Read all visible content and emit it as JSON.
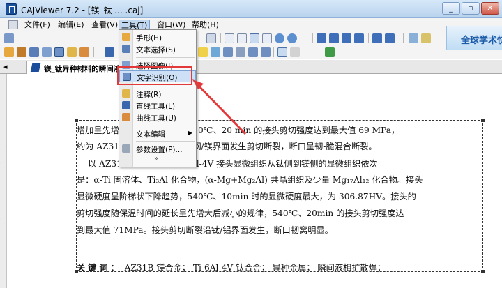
{
  "window": {
    "title": "CAJViewer 7.2 - [镁_钛 ... .caj]",
    "buttons": {
      "minimize": "_",
      "restore": "▫",
      "close": "✕"
    }
  },
  "menubar": {
    "items": [
      {
        "label": "文件(F)"
      },
      {
        "label": "编辑(E)"
      },
      {
        "label": "查看(V)"
      },
      {
        "label": "工具(T)",
        "active": true
      },
      {
        "label": "窗口(W)"
      },
      {
        "label": "帮助(H)"
      }
    ]
  },
  "tools_menu": {
    "items": [
      {
        "label": "手形(H)",
        "icon": "hand-icon"
      },
      {
        "label": "文本选择(S)",
        "icon": "text-select-icon"
      },
      {
        "label": "选择图像(I)",
        "icon": "image-select-icon"
      },
      {
        "label": "文字识别(O)",
        "icon": "ocr-icon",
        "highlighted": true
      },
      {
        "label": "注释(R)",
        "icon": "annotation-icon"
      },
      {
        "label": "直线工具(L)",
        "icon": "line-tool-icon"
      },
      {
        "label": "曲线工具(U)",
        "icon": "curve-tool-icon"
      },
      {
        "label": "文本编辑",
        "has_submenu": true
      },
      {
        "label": "参数设置(P)...",
        "icon": "settings-icon"
      }
    ],
    "more": "»"
  },
  "banner": {
    "text": "全球学术快"
  },
  "tab": {
    "title": "镁_钛异种材料的瞬间液"
  },
  "document": {
    "line1": "增加呈先增大后减小的规律，520℃、20 min 的接头剪切强度达到最大值 69 MPa，",
    "line2": "约为 AZ31B 母材的 ... 接头沿钢/镁界面发生剪切断裂，断口呈韧-脆混合断裂。",
    "line3": "以 AZ31B ... AZ31B/Ti-6Al-4V 接头显微组织从钛侧到镁侧的显微组织依次",
    "line4": "是：α-Ti 固溶体、Ti₃Al 化合物，(α-Mg+Mg₂Al) 共晶组织及少量 Mg₁₇Al₁₂ 化合物。接头",
    "line5": "显微硬度呈阶梯状下降趋势，540℃、10min 时的显微硬度最大，为 306.87HV。接头的",
    "line6": "剪切强度随保温时间的延长呈先增大后减小的规律，540℃、20min 的接头剪切强度达",
    "line7": "到最大值 71MPa。接头剪切断裂沿钛/铝界面发生，断口韧窝明显。",
    "keywords_label": "关键词：",
    "keywords": "AZ31B 镁合金；  Ti-6Al-4V 钛合金；  异种金属；  瞬间液相扩散焊；"
  },
  "colors": {
    "annotation": "#e23a3a",
    "highlight": "#cde0f6",
    "banner_text": "#1d5ca8"
  }
}
